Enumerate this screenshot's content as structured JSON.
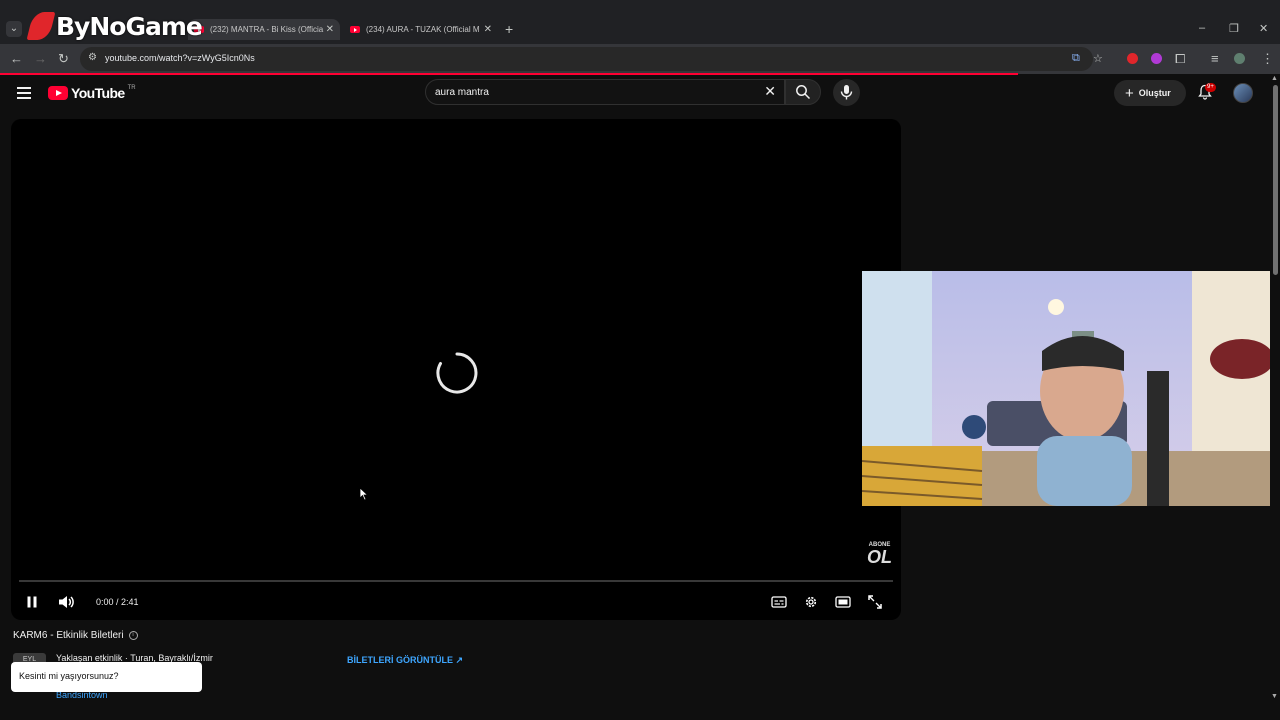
{
  "browser": {
    "overlay_logo": "ByNoGame",
    "tabs": [
      {
        "title": "(232) MANTRA - Bi Kiss (Officia",
        "active": true
      },
      {
        "title": "(234) AURA - TUZAK (Official M",
        "active": false
      }
    ],
    "url": "youtube.com/watch?v=zWyG5Icn0Ns"
  },
  "youtube": {
    "logo_word": "YouTube",
    "country_code": "TR",
    "search_query": "aura mantra",
    "create_label": "Oluştur",
    "notification_count": "9+"
  },
  "player": {
    "time_display": "0:00 / 2:41",
    "watermark_line1": "ABONE",
    "watermark_line2": "OL"
  },
  "event": {
    "title": "KARM6 - Etkinlik Biletleri",
    "date_badge": "EYL",
    "subtitle": "Yaklaşan etkinlik · Turan, Bayraklı/İzmir",
    "source": "Bandsintown",
    "tickets_label": "BİLETLERİ GÖRÜNTÜLE"
  },
  "toast": {
    "message": "Kesinti mi yaşıyorsunuz?"
  },
  "colors": {
    "accent_red": "#ff0033",
    "link_blue": "#3ea6ff",
    "background": "#0f0f0f"
  }
}
